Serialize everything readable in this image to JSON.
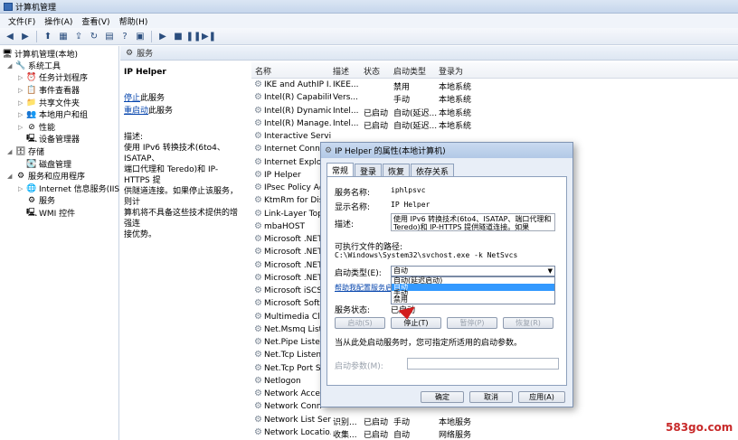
{
  "window": {
    "title": "计算机管理"
  },
  "menu": [
    "文件(F)",
    "操作(A)",
    "查看(V)",
    "帮助(H)"
  ],
  "toolbar_icons": [
    "back-icon",
    "forward-icon",
    "up-folder-icon",
    "console-tree-icon",
    "export-icon",
    "refresh-icon",
    "properties-icon",
    "help-icon",
    "pane-icon",
    "start-service-icon",
    "stop-service-icon",
    "pause-service-icon",
    "restart-service-icon"
  ],
  "tree": {
    "root": "计算机管理(本地)",
    "items": [
      {
        "label": "系统工具",
        "icon": "tools-icon"
      },
      {
        "label": "任务计划程序",
        "icon": "clock-icon"
      },
      {
        "label": "事件查看器",
        "icon": "event-viewer-icon"
      },
      {
        "label": "共享文件夹",
        "icon": "shared-folder-icon"
      },
      {
        "label": "本地用户和组",
        "icon": "users-icon"
      },
      {
        "label": "性能",
        "icon": "performance-icon"
      },
      {
        "label": "设备管理器",
        "icon": "device-manager-icon"
      },
      {
        "label": "存储",
        "icon": "storage-icon"
      },
      {
        "label": "磁盘管理",
        "icon": "disk-icon"
      },
      {
        "label": "服务和应用程序",
        "icon": "services-apps-icon"
      },
      {
        "label": "Internet 信息服务(IIS)管",
        "icon": "iis-icon"
      },
      {
        "label": "服务",
        "icon": "services-icon"
      },
      {
        "label": "WMI 控件",
        "icon": "wmi-icon"
      }
    ]
  },
  "pane_header": "服务",
  "description_pane": {
    "service_name": "IP Helper",
    "stop_link": "停止",
    "stop_suffix": "此服务",
    "restart_link": "重启动",
    "restart_suffix": "此服务",
    "desc_label": "描述:",
    "desc_lines": [
      "使用 IPv6 转换技术(6to4、ISATAP、",
      "端口代理和 Teredo)和 IP-HTTPS 提",
      "供隧道连接。如果停止该服务，则计",
      "算机将不具备这些技术提供的增强连",
      "接优势。"
    ]
  },
  "list": {
    "columns": [
      "名称",
      "描述",
      "状态",
      "启动类型",
      "登录为"
    ],
    "rows": [
      {
        "name": "IKE and AuthIP I...",
        "desc": "IKEE...",
        "status": "",
        "startup": "禁用",
        "logon": "本地系统"
      },
      {
        "name": "Intel(R) Capabilit...",
        "desc": "Vers...",
        "status": "",
        "startup": "手动",
        "logon": "本地系统"
      },
      {
        "name": "Intel(R) Dynamic...",
        "desc": "Intel...",
        "status": "已启动",
        "startup": "自动(延迟...",
        "logon": "本地系统"
      },
      {
        "name": "Intel(R) Manage...",
        "desc": "Intel...",
        "status": "已启动",
        "startup": "自动(延迟...",
        "logon": "本地系统"
      },
      {
        "name": "Interactive Servi...",
        "desc": "",
        "status": "",
        "startup": "",
        "logon": ""
      },
      {
        "name": "Internet Conn",
        "desc": "",
        "status": "",
        "startup": "",
        "logon": ""
      },
      {
        "name": "Internet Explor",
        "desc": "",
        "status": "",
        "startup": "",
        "logon": ""
      },
      {
        "name": "IP Helper",
        "desc": "",
        "status": "",
        "startup": "",
        "logon": ""
      },
      {
        "name": "IPsec Policy Ag",
        "desc": "",
        "status": "",
        "startup": "",
        "logon": ""
      },
      {
        "name": "KtmRm for Dis",
        "desc": "",
        "status": "",
        "startup": "",
        "logon": ""
      },
      {
        "name": "Link-Layer Top",
        "desc": "",
        "status": "",
        "startup": "",
        "logon": ""
      },
      {
        "name": "mbaHOST",
        "desc": "",
        "status": "",
        "startup": "",
        "logon": ""
      },
      {
        "name": "Microsoft .NET",
        "desc": "",
        "status": "",
        "startup": "",
        "logon": ""
      },
      {
        "name": "Microsoft .NET",
        "desc": "",
        "status": "",
        "startup": "",
        "logon": ""
      },
      {
        "name": "Microsoft .NET",
        "desc": "",
        "status": "",
        "startup": "",
        "logon": ""
      },
      {
        "name": "Microsoft .NET",
        "desc": "",
        "status": "",
        "startup": "",
        "logon": ""
      },
      {
        "name": "Microsoft iSCS",
        "desc": "",
        "status": "",
        "startup": "",
        "logon": ""
      },
      {
        "name": "Microsoft Soft",
        "desc": "",
        "status": "",
        "startup": "",
        "logon": ""
      },
      {
        "name": "Multimedia Cla",
        "desc": "",
        "status": "",
        "startup": "",
        "logon": ""
      },
      {
        "name": "Net.Msmq List",
        "desc": "",
        "status": "",
        "startup": "",
        "logon": ""
      },
      {
        "name": "Net.Pipe Listen",
        "desc": "",
        "status": "",
        "startup": "",
        "logon": ""
      },
      {
        "name": "Net.Tcp Listen",
        "desc": "",
        "status": "",
        "startup": "",
        "logon": ""
      },
      {
        "name": "Net.Tcp Port S",
        "desc": "",
        "status": "",
        "startup": "",
        "logon": ""
      },
      {
        "name": "Netlogon",
        "desc": "",
        "status": "",
        "startup": "",
        "logon": ""
      },
      {
        "name": "Network Acces",
        "desc": "",
        "status": "",
        "startup": "",
        "logon": ""
      },
      {
        "name": "Network Conn",
        "desc": "",
        "status": "",
        "startup": "",
        "logon": ""
      },
      {
        "name": "Network List Ser...",
        "desc": "识别...",
        "status": "已启动",
        "startup": "手动",
        "logon": "本地服务"
      },
      {
        "name": "Network Locatio...",
        "desc": "收集...",
        "status": "已启动",
        "startup": "自动",
        "logon": "网络服务"
      }
    ]
  },
  "dialog": {
    "title": "IP Helper 的属性(本地计算机)",
    "tabs": [
      "常规",
      "登录",
      "恢复",
      "依存关系"
    ],
    "service_name_label": "服务名称:",
    "service_name_value": "iphlpsvc",
    "display_name_label": "显示名称:",
    "display_name_value": "IP Helper",
    "desc_label": "描述:",
    "desc_value": "使用 IPv6 转换技术(6to4、ISATAP、端口代理和 Teredo)和 IP-HTTPS 提供隧道连接。如果",
    "path_label": "可执行文件的路径:",
    "path_value": "C:\\Windows\\System32\\svchost.exe -k NetSvcs",
    "startup_label": "启动类型(E):",
    "startup_value": "自动",
    "startup_options": [
      "自动(延迟启动)",
      "自动",
      "手动",
      "禁用"
    ],
    "help_link": "帮助我配置服务启",
    "status_label": "服务状态:",
    "status_value": "已启动",
    "buttons": {
      "start": "启动(S)",
      "stop": "停止(T)",
      "pause": "暂停(P)",
      "resume": "恢复(R)"
    },
    "hint": "当从此处启动服务时，您可指定所适用的启动参数。",
    "param_label": "启动参数(M):",
    "ok": "确定",
    "cancel": "取消",
    "apply": "应用(A)"
  },
  "watermark": "583go.com",
  "colors": {
    "accent": "#3399ff",
    "link": "#0645ad",
    "watermark": "#c82a2a"
  }
}
